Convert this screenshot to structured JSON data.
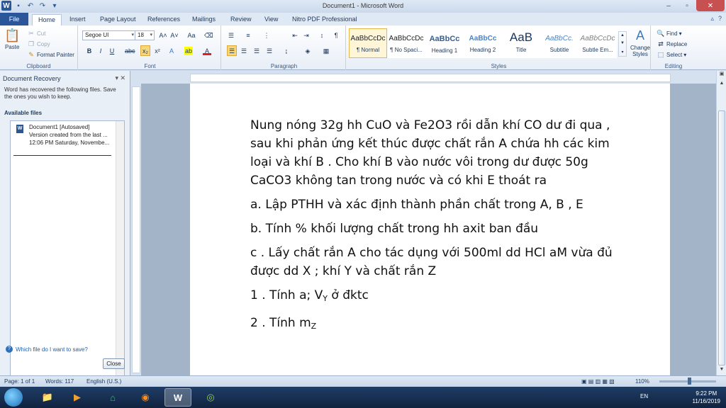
{
  "window": {
    "title": "Document1 - Microsoft Word"
  },
  "tabs": [
    "File",
    "Home",
    "Insert",
    "Page Layout",
    "References",
    "Mailings",
    "Review",
    "View",
    "Nitro PDF Professional"
  ],
  "clipboard": {
    "paste": "Paste",
    "cut": "Cut",
    "copy": "Copy",
    "format_painter": "Format Painter",
    "label": "Clipboard"
  },
  "font": {
    "name": "Segoe UI",
    "size": "18",
    "label": "Font"
  },
  "paragraph": {
    "label": "Paragraph"
  },
  "styles": {
    "label": "Styles",
    "items": [
      {
        "sample": "AaBbCcDc",
        "name": "¶ Normal"
      },
      {
        "sample": "AaBbCcDc",
        "name": "¶ No Spaci..."
      },
      {
        "sample": "AaBbCc",
        "name": "Heading 1"
      },
      {
        "sample": "AaBbCc",
        "name": "Heading 2"
      },
      {
        "sample": "AaB",
        "name": "Title"
      },
      {
        "sample": "AaBbCc.",
        "name": "Subtitle"
      },
      {
        "sample": "AaBbCcDc",
        "name": "Subtle Em..."
      }
    ],
    "change_styles": "Change Styles"
  },
  "editing": {
    "find": "Find",
    "replace": "Replace",
    "select": "Select",
    "label": "Editing"
  },
  "recovery": {
    "title": "Document Recovery",
    "desc": "Word has recovered the following files.  Save the ones you wish to keep.",
    "available": "Available files",
    "file_name": "Document1  [Autosaved]",
    "file_line2": "Version created from the last ...",
    "file_line3": "12:06 PM Saturday, Novembe...",
    "help": "Which file do I want to save?",
    "close": "Close"
  },
  "document": {
    "p1": "Nung nóng 32g hh CuO và Fe2O3 rồi dẫn khí CO dư đi qua , sau khi phản ứng kết thúc được chất rắn A chứa hh các kim loại và khí B . Cho khí B vào nước vôi trong dư được 50g CaCO3 không tan trong nước và có khi E thoát ra",
    "p2": "a. Lập PTHH và xác định thành phần chất trong A, B , E",
    "p3": "b. Tính % khối lượng chất trong hh axit ban đầu",
    "p4": "c . Lấy chất rắn A cho tác dụng với 500ml dd HCl aM vừa đủ được dd X ; khí Y và chất rắn Z",
    "p5_pre": "1 . Tính a; V",
    "p5_sub": "Y",
    "p5_post": " ở đktc",
    "p6_pre": "2 . Tính m",
    "p6_sub": "Z"
  },
  "status": {
    "page": "Page: 1 of 1",
    "words": "Words: 117",
    "lang": "English (U.S.)",
    "zoom": "110%"
  },
  "taskbar": {
    "lang": "EN",
    "time": "9:22 PM",
    "date": "11/16/2019"
  }
}
